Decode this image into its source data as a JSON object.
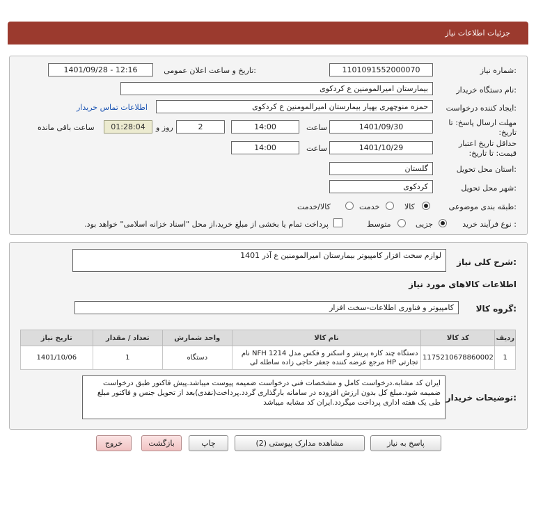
{
  "header": {
    "title": "جزئیات اطلاعات نیاز"
  },
  "need": {
    "number_label": "شماره نیاز:",
    "number_value": "1101091552000070",
    "announce_label": "تاریخ و ساعت اعلان عمومی:",
    "announce_value": "1401/09/28 - 12:16",
    "buyer_org_label": "نام دستگاه خریدار:",
    "buyer_org_value": "بیمارستان امیرالمومنین  ع  کردکوی",
    "requester_label": "ایجاد کننده درخواست:",
    "requester_value": "حمزه  منوچهری بهیار بیمارستان امیرالمومنین  ع  کردکوی",
    "contact_link": "اطلاعات تماس خریدار",
    "reply_deadline_label": "مهلت ارسال پاسخ: تا تاریخ:",
    "reply_date": "1401/09/30",
    "time_label": "ساعت",
    "reply_time": "14:00",
    "days_value": "2",
    "days_label": "روز و",
    "remaining_time": "01:28:04",
    "remaining_label": "ساعت باقی مانده",
    "validity_label": "حداقل تاریخ اعتبار قیمت: تا تاریخ:",
    "validity_date": "1401/10/29",
    "validity_time_label": "ساعت",
    "validity_time": "14:00",
    "province_label": "استان محل تحویل:",
    "province_value": "گلستان",
    "city_label": "شهر محل تحویل:",
    "city_value": "کردکوی",
    "category_label": "طبقه بندی موضوعی:",
    "category_options": [
      "کالا",
      "خدمت",
      "کالا/خدمت"
    ],
    "category_selected": "کالا",
    "process_label": "نوع فرآیند خرید :",
    "process_options": [
      "جزیی",
      "متوسط"
    ],
    "process_selected": "جزیی",
    "treasury_note": "پرداخت تمام یا بخشی از مبلغ خرید،از محل \"اسناد خزانه اسلامی\" خواهد بود."
  },
  "summary": {
    "label": "شرح کلی نیاز:",
    "value": "لوازم سخت افزار کامپیوتر بیمارستان امیرالمومنین ع آذر 1401"
  },
  "goods": {
    "section_title": "اطلاعات کالاهای مورد نیاز",
    "group_label": "گروه کالا:",
    "group_value": "کامپیوتر و فناوری اطلاعات-سخت افزار",
    "columns": [
      "ردیف",
      "کد کالا",
      "نام کالا",
      "واحد شمارش",
      "تعداد / مقدار",
      "تاریخ نیاز"
    ],
    "rows": [
      {
        "row": "1",
        "code": "1175210678860002",
        "name": "دستگاه چند کاره پرینتر و اسکنر و فکس مدل NFH 1214 نام تجارتی HP مرجع عرضه کننده جعفر حاجی زاده ساطله لی",
        "unit": "دستگاه",
        "qty": "1",
        "date": "1401/10/06"
      }
    ]
  },
  "notes": {
    "label": "توضیحات خریدار:",
    "value": "ایران کد مشابه.درخواست کامل و مشخصات فنی درخواست ضمیمه پیوست میباشد.پیش فاکتور طبق درخواست ضمیمه شود.مبلغ کل بدون ارزش افزوده در سامانه بارگذاری گردد.پرداخت(نقدی)بعد از تحویل جنس و فاکتور مبلغ طی یک هفته اداری پرداخت میگردد.ایران کد مشابه میباشد"
  },
  "buttons": {
    "reply": "پاسخ به نیاز",
    "attachments": "مشاهده مدارک پیوستی (2)",
    "print": "چاپ",
    "back": "بازگشت",
    "exit": "خروج"
  }
}
